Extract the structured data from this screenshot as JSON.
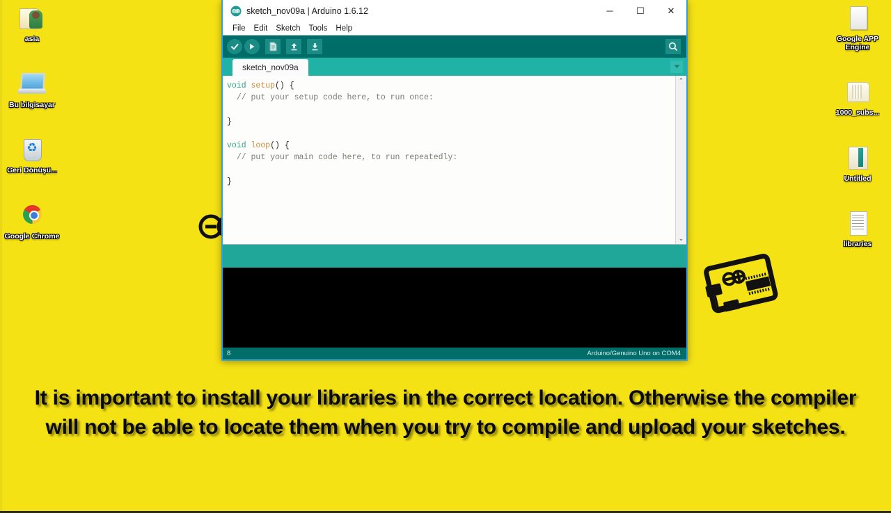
{
  "desktop": {
    "background_color": "#f5e215",
    "icons_left": [
      {
        "label": "asia",
        "icon": "user-folder-icon",
        "art": "art-folder-user"
      },
      {
        "label": "Bu bilgisayar",
        "icon": "computer-icon",
        "art": "art-computer"
      },
      {
        "label": "Geri Dönüşü...",
        "icon": "recycle-bin-icon",
        "art": "art-recycle"
      },
      {
        "label": "Google Chrome",
        "icon": "chrome-icon",
        "art": "art-chrome"
      }
    ],
    "icons_right": [
      {
        "label": "Google APP Engine",
        "icon": "blank-document-icon",
        "art": "art-doc-blank"
      },
      {
        "label": "1000_subs...",
        "icon": "folder-icon",
        "art": "art-folder-pale"
      },
      {
        "label": "Untitled",
        "icon": "book-icon",
        "art": "art-book"
      },
      {
        "label": "libraries",
        "icon": "text-document-icon",
        "art": "art-lines-doc"
      }
    ]
  },
  "ide": {
    "title": "sketch_nov09a | Arduino 1.6.12",
    "logo_icon": "arduino-infinity-logo",
    "window_controls": {
      "minimize": "─",
      "maximize": "☐",
      "close": "✕"
    },
    "menu": [
      {
        "label": "File"
      },
      {
        "label": "Edit"
      },
      {
        "label": "Sketch"
      },
      {
        "label": "Tools"
      },
      {
        "label": "Help"
      }
    ],
    "toolbar": [
      {
        "name": "verify-button",
        "icon": "checkmark-icon",
        "shape": "round"
      },
      {
        "name": "upload-button",
        "icon": "arrow-right-icon",
        "shape": "round"
      },
      {
        "name": "new-button",
        "icon": "new-file-icon",
        "shape": "square"
      },
      {
        "name": "open-button",
        "icon": "arrow-up-icon",
        "shape": "square"
      },
      {
        "name": "save-button",
        "icon": "arrow-down-icon",
        "shape": "square"
      }
    ],
    "serial_monitor_icon": "magnifier-icon",
    "tab_label": "sketch_nov09a",
    "tab_menu_icon": "chevron-down-icon",
    "scrollbar": {
      "up_icon": "⌃",
      "down_icon": "⌄"
    },
    "code": {
      "lines": [
        "void setup() {",
        "  // put your setup code here, to run once:",
        "",
        "}",
        "",
        "void loop() {",
        "  // put your main code here, to run repeatedly:",
        "",
        "}"
      ]
    },
    "status": {
      "line_number": "8",
      "board": "Arduino/Genuino Uno on COM4"
    },
    "colors": {
      "toolbar": "#006d68",
      "tab_strip": "#20B2A4",
      "teal_pane": "#20A79A",
      "console": "#000000",
      "window_border": "#35a0d8"
    }
  },
  "watermarks": {
    "infinity_logo": "arduino-infinity-watermark",
    "board_logo": "arduino-board-watermark"
  },
  "caption": {
    "text": "It is important to install your libraries in the correct location. Otherwise the compiler will not be able to locate them when you try to compile and upload your sketches."
  }
}
